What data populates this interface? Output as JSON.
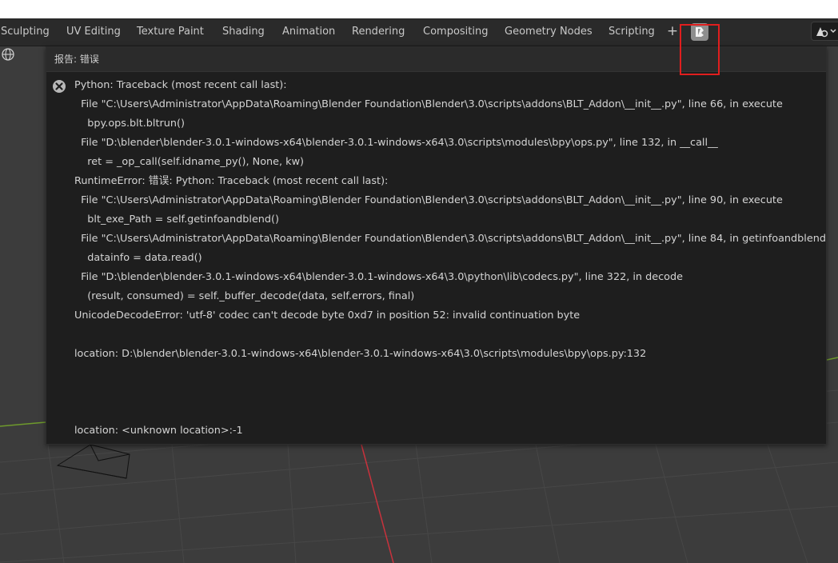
{
  "tabs": [
    "Sculpting",
    "UV Editing",
    "Texture Paint",
    "Shading",
    "Animation",
    "Rendering",
    "Compositing",
    "Geometry Nodes",
    "Scripting"
  ],
  "add_tab_label": "+",
  "report": {
    "title": "报告: 错误",
    "lines": [
      "Python: Traceback (most recent call last):",
      "  File \"C:\\Users\\Administrator\\AppData\\Roaming\\Blender Foundation\\Blender\\3.0\\scripts\\addons\\BLT_Addon\\__init__.py\", line 66, in execute",
      "    bpy.ops.blt.bltrun()",
      "  File \"D:\\blender\\blender-3.0.1-windows-x64\\blender-3.0.1-windows-x64\\3.0\\scripts\\modules\\bpy\\ops.py\", line 132, in __call__",
      "    ret = _op_call(self.idname_py(), None, kw)",
      "RuntimeError: 错误: Python: Traceback (most recent call last):",
      "  File \"C:\\Users\\Administrator\\AppData\\Roaming\\Blender Foundation\\Blender\\3.0\\scripts\\addons\\BLT_Addon\\__init__.py\", line 90, in execute",
      "    blt_exe_Path = self.getinfoandblend()",
      "  File \"C:\\Users\\Administrator\\AppData\\Roaming\\Blender Foundation\\Blender\\3.0\\scripts\\addons\\BLT_Addon\\__init__.py\", line 84, in getinfoandblend",
      "    datainfo = data.read()",
      "  File \"D:\\blender\\blender-3.0.1-windows-x64\\blender-3.0.1-windows-x64\\3.0\\python\\lib\\codecs.py\", line 322, in decode",
      "    (result, consumed) = self._buffer_decode(data, self.errors, final)",
      "UnicodeDecodeError: 'utf-8' codec can't decode byte 0xd7 in position 52: invalid continuation byte",
      "",
      "location: D:\\blender\\blender-3.0.1-windows-x64\\blender-3.0.1-windows-x64\\3.0\\scripts\\modules\\bpy\\ops.py:132",
      "",
      "",
      "",
      "location: <unknown location>:-1"
    ]
  },
  "colors": {
    "highlight": "#e01e1e",
    "viewport_bg": "#3c3c3c",
    "panel_bg": "#1e1e1e",
    "error_icon": "#b8b8b8",
    "axis_x": "#c8323c",
    "axis_y": "#6e9a2c"
  },
  "icons": [
    "blt-addon-icon",
    "error-icon",
    "editor-type-icon",
    "globe-icon"
  ]
}
